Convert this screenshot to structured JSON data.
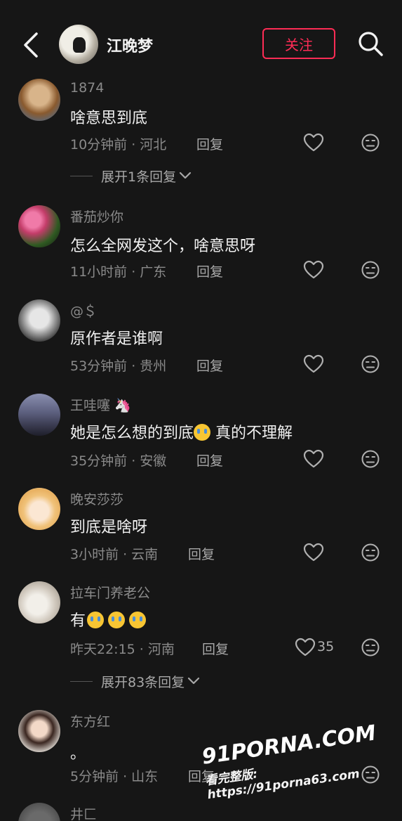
{
  "header": {
    "name": "江晚梦",
    "follow_label": "关注"
  },
  "comments": [
    {
      "user": "1874",
      "text": "啥意思到底",
      "time": "10分钟前",
      "region": "河北",
      "reply": "回复",
      "likes": "",
      "expand": "展开1条回复"
    },
    {
      "user": "番茄炒你",
      "text": "怎么全网发这个，啥意思呀",
      "time": "11小时前",
      "region": "广东",
      "reply": "回复",
      "likes": ""
    },
    {
      "user": "@＄",
      "text": "原作者是谁啊",
      "time": "53分钟前",
      "region": "贵州",
      "reply": "回复",
      "likes": ""
    },
    {
      "user": "王哇噻 🦄",
      "text": "她是怎么想的到底",
      "text_suffix": "真的不理解",
      "time": "35分钟前",
      "region": "安徽",
      "reply": "回复",
      "likes": ""
    },
    {
      "user": "晚安莎莎",
      "text": "到底是啥呀",
      "time": "3小时前",
      "region": "云南",
      "reply": "回复",
      "likes": ""
    },
    {
      "user": "拉车门养老公",
      "text": "有",
      "time": "昨天22:15",
      "region": "河南",
      "reply": "回复",
      "likes": "35",
      "expand": "展开83条回复"
    },
    {
      "user": "东方红",
      "text": "。",
      "time": "5分钟前",
      "region": "山东",
      "reply": "回复",
      "likes": ""
    },
    {
      "user": "井匚"
    }
  ],
  "watermark": {
    "logo": "91PORNA.COM",
    "url": "看完整版: https://91porna63.com"
  },
  "icons": [
    "back-arrow-icon",
    "search-icon",
    "heart-icon",
    "dislike-face-icon",
    "chevron-down-icon",
    "crying-emoji-icon"
  ],
  "colors": {
    "accent": "#fe2c55",
    "background": "#161616"
  }
}
